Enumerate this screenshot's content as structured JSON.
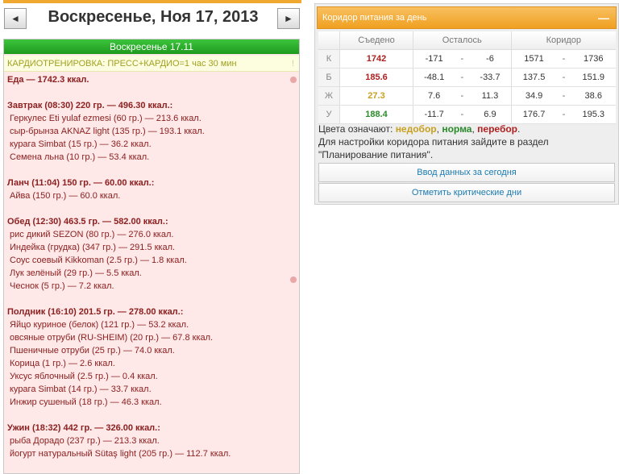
{
  "nav": {
    "prev": "◄",
    "next": "►",
    "title": "Воскресенье, Ноя 17, 2013"
  },
  "day": {
    "header": "Воскресенье 17.11",
    "cardio": "КАРДИОТРЕНИРОВКА: ПРЕСС+КАРДИО=1 час 30 мин",
    "cardio_mark": "!",
    "total": "Еда — 1742.3 ккал.",
    "meals": [
      {
        "head": "Завтрак (08:30) 220 гр. — 496.30 ккал.:",
        "items": [
          "Геркулес Eti yulaf ezmesi (60 гр.) — 213.6 ккал.",
          "сыр-брынза AKNAZ light (135 гр.) — 193.1 ккал.",
          "курага Simbat (15 гр.) — 36.2 ккал.",
          "Семена льна (10 гр.) — 53.4 ккал."
        ]
      },
      {
        "head": "Ланч (11:04) 150 гр. — 60.00 ккал.:",
        "items": [
          "Айва (150 гр.) — 60.0 ккал."
        ]
      },
      {
        "head": "Обед (12:30) 463.5 гр. — 582.00 ккал.:",
        "items": [
          "рис дикий SEZON (80 гр.) — 276.0 ккал.",
          "Индейка (грудка) (347 гр.) — 291.5 ккал.",
          "Соус соевый Kikkoman (2.5 гр.) — 1.8 ккал.",
          "Лук зелёный (29 гр.) — 5.5 ккал.",
          "Чеснок (5 гр.) — 7.2 ккал."
        ]
      },
      {
        "head": "Полдник (16:10) 201.5 гр. — 278.00 ккал.:",
        "items": [
          "Яйцо куриное (белок) (121 гр.) — 53.2 ккал.",
          "овсяные отруби (RU-SHEIM) (20 гр.) — 67.8 ккал.",
          "Пшеничные отруби (25 гр.) — 74.0 ккал.",
          "Корица (1 гр.) — 2.6 ккал.",
          "Уксус яблочный (2.5 гр.) — 0.4 ккал.",
          "курага Simbat (14 гр.) — 33.7 ккал.",
          "Инжир сушеный (18 гр.) — 46.3 ккал."
        ]
      },
      {
        "head": "Ужин (18:32) 442 гр. — 326.00 ккал.:",
        "items": [
          "рыба Дорадо (237 гр.) — 213.3 ккал.",
          "йогурт натуральный Sütaş light (205 гр.) — 112.7 ккал."
        ]
      }
    ]
  },
  "corridor": {
    "title": "Коридор питания за день",
    "collapse": "—",
    "headers": [
      "Съедено",
      "Осталось",
      "Коридор"
    ],
    "dash": "-",
    "rows": [
      {
        "label": "К",
        "eaten": "1742",
        "eaten_color": "#b02020",
        "left_min": "-171",
        "left_max": "-6",
        "corr_min": "1571",
        "corr_max": "1736"
      },
      {
        "label": "Б",
        "eaten": "185.6",
        "eaten_color": "#b02020",
        "left_min": "-48.1",
        "left_max": "-33.7",
        "corr_min": "137.5",
        "corr_max": "151.9"
      },
      {
        "label": "Ж",
        "eaten": "27.3",
        "eaten_color": "#c8a020",
        "left_min": "7.6",
        "left_max": "11.3",
        "corr_min": "34.9",
        "corr_max": "38.6"
      },
      {
        "label": "У",
        "eaten": "188.4",
        "eaten_color": "#2a8a2a",
        "left_min": "-11.7",
        "left_max": "6.9",
        "corr_min": "176.7",
        "corr_max": "195.3"
      }
    ],
    "legend_prefix": "Цвета означают:",
    "legend_under": "недобор",
    "legend_norm": "норма",
    "legend_over": "перебор",
    "legend_end": ".",
    "note": "Для настройки коридора питания зайдите в раздел \"Планирование питания\".",
    "btn_enter": "Ввод данных за сегодня",
    "btn_critical": "Отметить критические дни"
  }
}
